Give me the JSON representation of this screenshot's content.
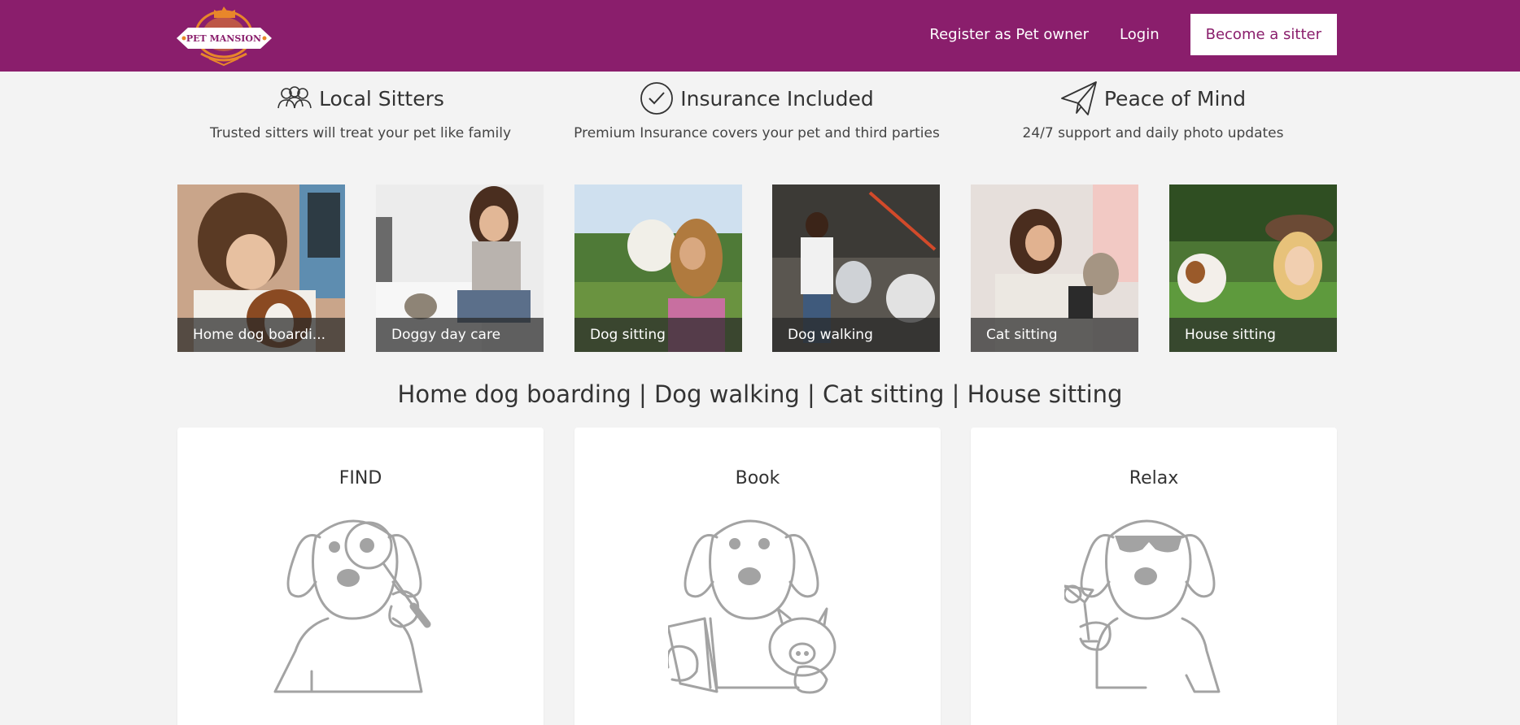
{
  "header": {
    "logo_text": "PET MANSION",
    "nav": {
      "register_label": "Register as Pet owner",
      "login_label": "Login",
      "become_sitter_label": "Become a sitter"
    }
  },
  "colors": {
    "brand": "#8a1e6c",
    "logo_orange": "#e8872a",
    "caption_bg": "#2a2a2a",
    "illustration_gray": "#a3a3a3"
  },
  "features": [
    {
      "icon": "people-icon",
      "title": "Local Sitters",
      "desc": "Trusted sitters will treat your pet like family"
    },
    {
      "icon": "check-circle-icon",
      "title": "Insurance Included",
      "desc": "Premium Insurance covers your pet and third parties"
    },
    {
      "icon": "paper-plane-icon",
      "title": "Peace of Mind",
      "desc": "24/7 support and daily photo updates"
    }
  ],
  "services": [
    {
      "label": "Home dog boardi..."
    },
    {
      "label": "Doggy day care"
    },
    {
      "label": "Dog sitting"
    },
    {
      "label": "Dog walking"
    },
    {
      "label": "Cat sitting"
    },
    {
      "label": "House sitting"
    }
  ],
  "tagline": "Home dog boarding | Dog walking | Cat sitting | House sitting",
  "steps": [
    {
      "title": "FIND",
      "icon": "dog-magnifier-icon"
    },
    {
      "title": "Book",
      "icon": "dog-piggybank-icon"
    },
    {
      "title": "Relax",
      "icon": "dog-sunglasses-icon"
    }
  ]
}
